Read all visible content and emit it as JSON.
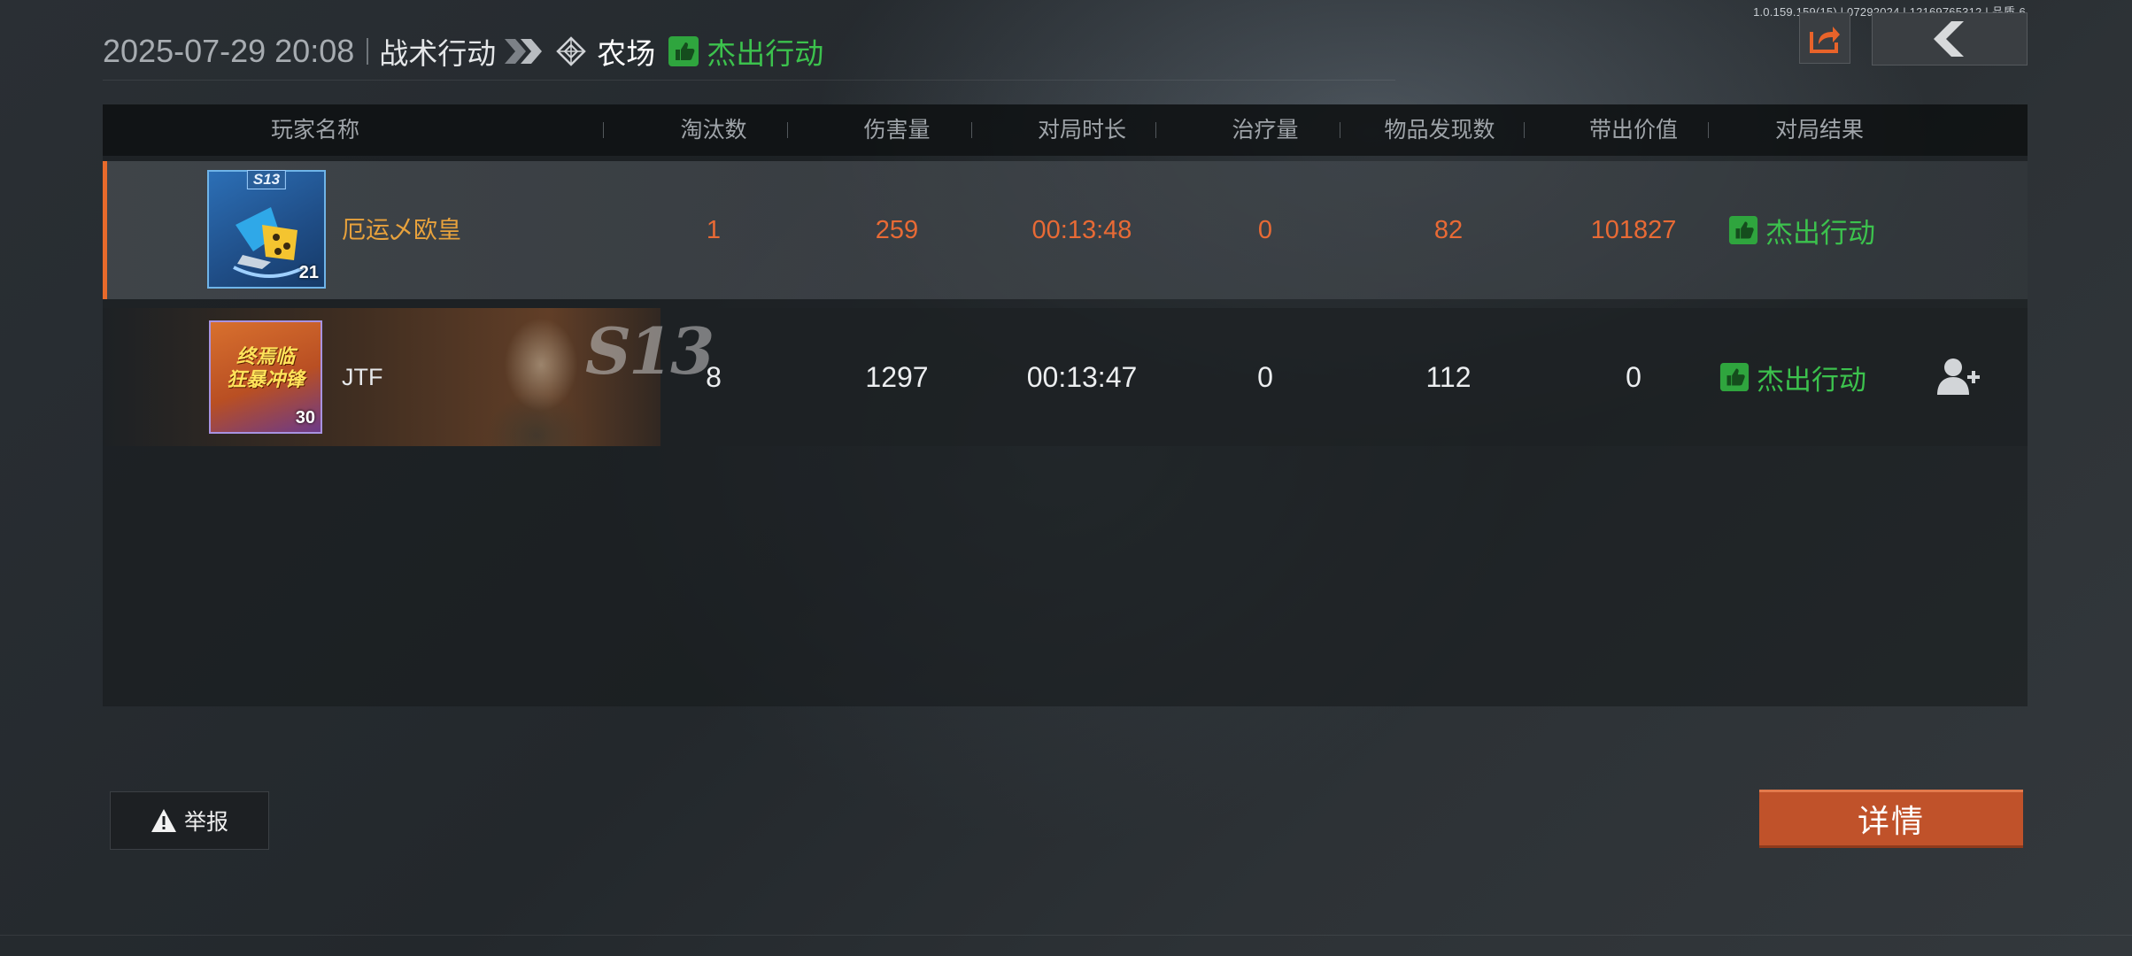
{
  "version_info": "1.0.159.159(15) | 07292024 | 12169765312 | 品质-6",
  "header": {
    "datetime": "2025-07-29 20:08",
    "mode": "战术行动",
    "map": "农场",
    "result": "杰出行动"
  },
  "table": {
    "columns": [
      "玩家名称",
      "淘汰数",
      "伤害量",
      "对局时长",
      "治疗量",
      "物品发现数",
      "带出价值",
      "对局结果"
    ],
    "rows": [
      {
        "avatar_badge": "S13",
        "level": "21",
        "name": "厄运乄欧皇",
        "eliminations": "1",
        "damage": "259",
        "duration": "00:13:48",
        "healing": "0",
        "items_found": "82",
        "extract_value": "101827",
        "result": "杰出行动"
      },
      {
        "level": "30",
        "avatar_text": "终焉临\n狂暴冲锋",
        "banner_text": "S13",
        "name": "JTF",
        "eliminations": "8",
        "damage": "1297",
        "duration": "00:13:47",
        "healing": "0",
        "items_found": "112",
        "extract_value": "0",
        "result": "杰出行动"
      }
    ]
  },
  "buttons": {
    "report": "举报",
    "details": "详情"
  },
  "colors": {
    "accent_orange": "#e86a35",
    "success_green": "#3cc24d",
    "detail_button": "#c0522a"
  }
}
